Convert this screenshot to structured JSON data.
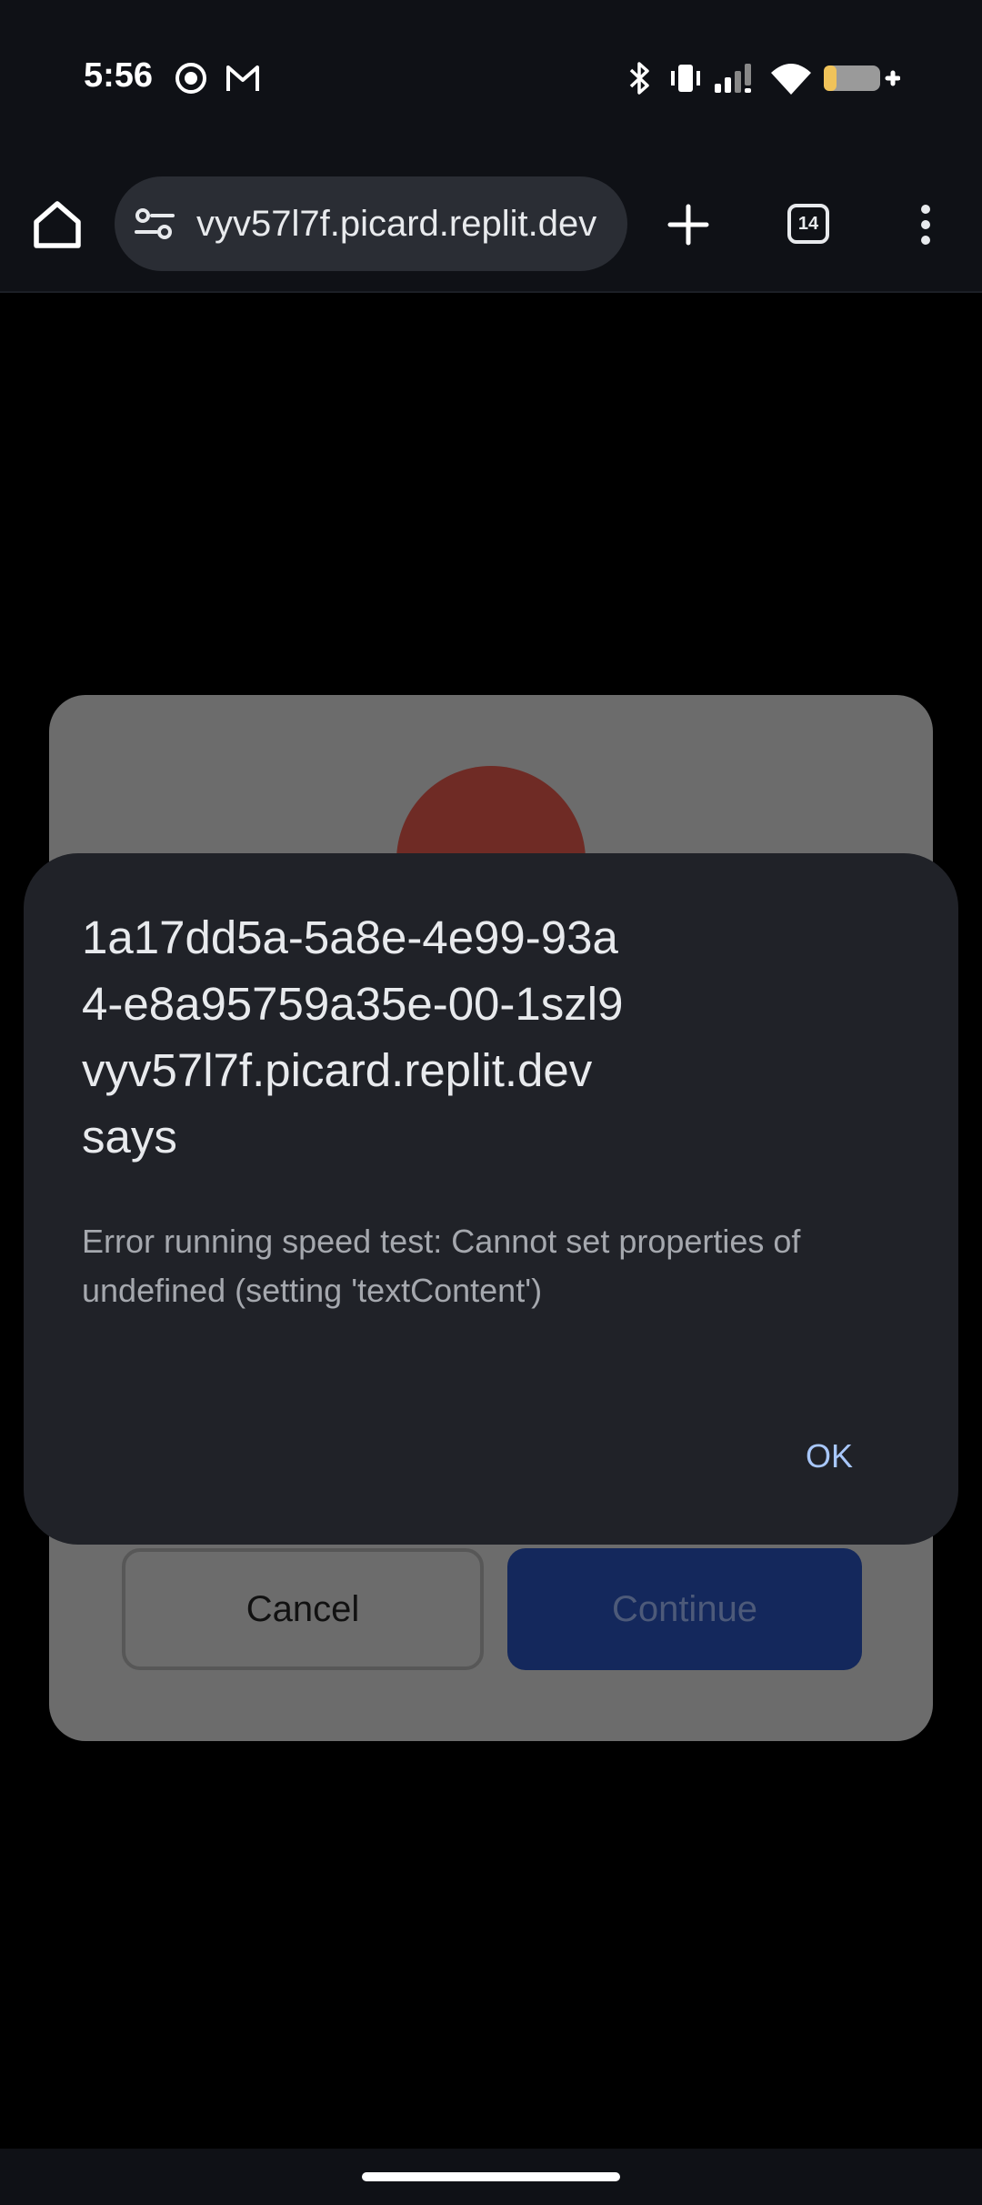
{
  "status_bar": {
    "time": "5:56",
    "icons": [
      "screen-record-icon",
      "gmail-icon",
      "bluetooth-icon",
      "vibrate-icon",
      "signal-icon",
      "wifi-icon",
      "battery-charging-icon"
    ]
  },
  "browser": {
    "url": "vyv57l7f.picard.replit.dev",
    "tab_count": "14",
    "icons": [
      "home-icon",
      "tune-icon",
      "plus-icon",
      "more-vert-icon"
    ]
  },
  "background_dialog": {
    "cancel_label": "Cancel",
    "continue_label": "Continue"
  },
  "alert": {
    "title_lines": [
      "1a17dd5a-5a8e-4e99-93a",
      "4-e8a95759a35e-00-1szl9",
      "vyv57l7f.picard.replit.dev",
      "says"
    ],
    "message": "Error running speed test: Cannot set properties of undefined (setting 'textContent')",
    "ok_label": "OK"
  },
  "colors": {
    "accent": "#a8c7fa",
    "dialog_bg": "#202228",
    "toolbar_bg": "#0f1116"
  }
}
